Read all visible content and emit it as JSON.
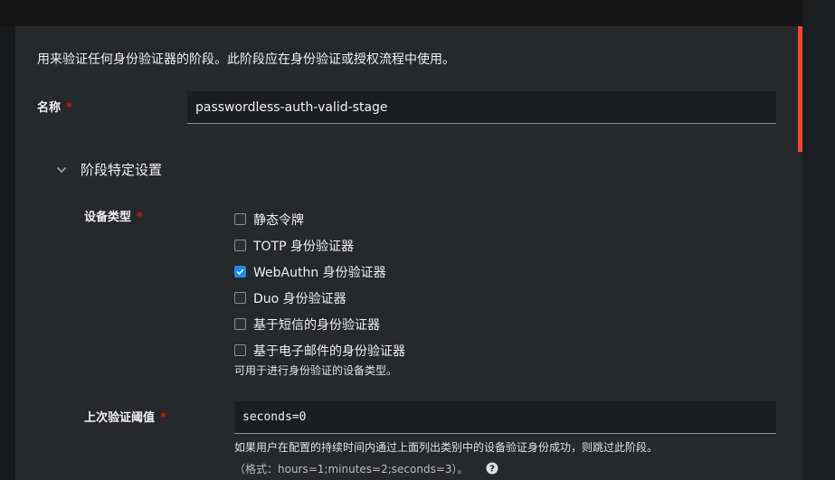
{
  "description": "用来验证任何身份验证器的阶段。此阶段应在身份验证或授权流程中使用。",
  "name_field": {
    "label": "名称",
    "required_marker": "*",
    "value": "passwordless-auth-valid-stage"
  },
  "stage_settings": {
    "title": "阶段特定设置",
    "expanded": true,
    "device_classes": {
      "label": "设备类型",
      "required_marker": "*",
      "options": [
        {
          "label": "静态令牌",
          "checked": false
        },
        {
          "label": "TOTP 身份验证器",
          "checked": false
        },
        {
          "label": "WebAuthn 身份验证器",
          "checked": true
        },
        {
          "label": "Duo 身份验证器",
          "checked": false
        },
        {
          "label": "基于短信的身份验证器",
          "checked": false
        },
        {
          "label": "基于电子邮件的身份验证器",
          "checked": false
        }
      ],
      "helper": "可用于进行身份验证的设备类型。"
    },
    "last_auth_threshold": {
      "label": "上次验证阈值",
      "required_marker": "*",
      "value": "seconds=0",
      "helper": "如果用户在配置的持续时间内通过上面列出类别中的设备验证身份成功，则跳过此阶段。",
      "format_hint": "（格式：hours=1;minutes=2;seconds=3）。"
    }
  },
  "colors": {
    "accent": "#ee4a32",
    "required": "#c9190b",
    "checkbox_checked": "#1f8bf0",
    "panel_bg": "#26282b"
  }
}
